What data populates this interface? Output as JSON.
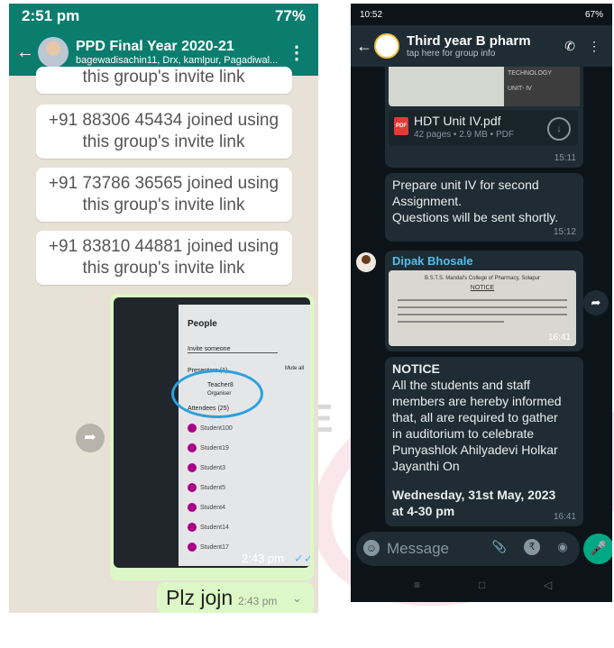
{
  "watermark": "GE",
  "left": {
    "status_bar": {
      "time": "2:51 pm",
      "battery": "77%"
    },
    "header": {
      "title": "PPD Final Year 2020-21",
      "subtitle": "bagewadisachin11, Drx, kamlpur, Pagadiwal..."
    },
    "messages": [
      {
        "line1": "this group's invite link",
        "line2": ""
      },
      {
        "line1": "+91 88306 45434 joined using",
        "line2": "this group's invite link"
      },
      {
        "line1": "+91 73786 36565 joined using",
        "line2": "this group's invite link"
      },
      {
        "line1": "+91 83810 44881 joined using",
        "line2": "this group's invite link"
      }
    ],
    "image_message": {
      "time": "2:43 pm",
      "photo_text": {
        "title": "People",
        "invite": "Invite someone",
        "mute": "Mute all",
        "presenters": "Presenters (1)",
        "teacher": "Teacher8",
        "organiser": "Organiser",
        "attendees": "Attendees (25)",
        "students": [
          "Student100",
          "Student19",
          "Student3",
          "Student5",
          "Student4",
          "Student14",
          "Student17"
        ]
      }
    },
    "text_message": {
      "text": "Plz jojn",
      "time": "2:43 pm"
    }
  },
  "right": {
    "status_bar": {
      "time": "10:52",
      "battery": "67%"
    },
    "header": {
      "title": "Third year B pharm",
      "subtitle": "tap here for group info"
    },
    "doc_message": {
      "thumb_text_1": "TECHNOLOGY",
      "thumb_text_2": "UNIT- IV",
      "filename": "HDT Unit IV.pdf",
      "meta": "42 pages • 2.9 MB • PDF",
      "time": "15:11"
    },
    "text_message_1": {
      "lines": [
        "Prepare unit IV for second",
        "Assignment.",
        "Questions will be sent shortly."
      ],
      "time": "15:12"
    },
    "notice_message": {
      "sender": "Dipak Bhosale",
      "img_header": "B.S.T.S. Mandal's College of Pharmacy, Solapur",
      "img_title": "NOTICE",
      "img_time": "16:41",
      "heading": "NOTICE",
      "body_lines": [
        "All the students and staff",
        "members are hereby informed",
        "that, all are required to gather",
        "in auditorium to celebrate",
        "Punyashlok Ahilyadevi Holkar",
        "Jayanthi On"
      ],
      "date_line_1": "Wednesday, 31st May, 2023",
      "date_line_2": "at 4-30 pm",
      "time": "16:41"
    },
    "composer": {
      "placeholder": "Message"
    }
  },
  "colors": {
    "left_header": "#0a7d6e",
    "left_bg": "#e8e1d6",
    "outgoing_bubble": "#dcf8c6",
    "right_bg": "#0c141a",
    "right_bubble": "#1f2c34",
    "sender_name": "#53bdeb",
    "accent_green": "#00a884"
  },
  "icons": [
    "back-arrow-icon",
    "more-vert-icon",
    "forward-icon",
    "double-check-icon",
    "chevron-down-icon",
    "pdf-icon",
    "download-icon",
    "add-call-icon",
    "emoji-icon",
    "attach-icon",
    "rupee-icon",
    "camera-icon",
    "mic-icon"
  ]
}
